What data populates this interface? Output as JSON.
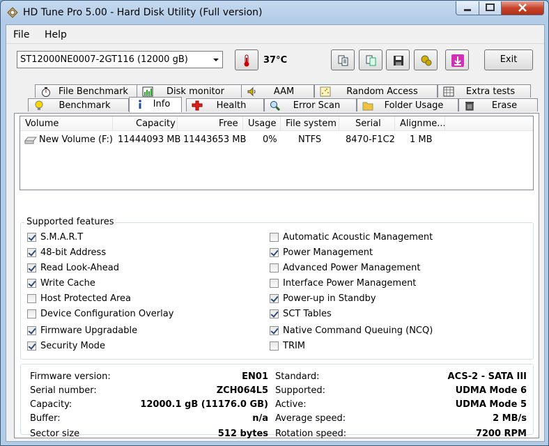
{
  "window": {
    "title": "HD Tune Pro 5.00 - Hard Disk Utility (Full version)"
  },
  "menu": {
    "file": "File",
    "help": "Help"
  },
  "toolbar": {
    "drive": "ST12000NE0007-2GT116 (12000 gB)",
    "temperature": "37°C",
    "exit_label": "Exit"
  },
  "tabs_top": [
    {
      "label": "File Benchmark",
      "icon": "stopwatch-icon"
    },
    {
      "label": "Disk monitor",
      "icon": "chart-icon"
    },
    {
      "label": "AAM",
      "icon": "speaker-icon"
    },
    {
      "label": "Random Access",
      "icon": "scatter-icon"
    },
    {
      "label": "Extra tests",
      "icon": "grid-icon"
    }
  ],
  "tabs_bottom": [
    {
      "label": "Benchmark",
      "icon": "bulb-icon"
    },
    {
      "label": "Info",
      "icon": "info-icon"
    },
    {
      "label": "Health",
      "icon": "cross-icon"
    },
    {
      "label": "Error Scan",
      "icon": "magnifier-icon"
    },
    {
      "label": "Folder Usage",
      "icon": "folder-icon"
    },
    {
      "label": "Erase",
      "icon": "trash-icon"
    }
  ],
  "volumes": {
    "headers": [
      "Volume",
      "Capacity",
      "Free",
      "Usage",
      "File system",
      "Serial",
      "Alignme..."
    ],
    "rows": [
      [
        "New Volume (F:)",
        "11444093 MB",
        "11443653 MB",
        "0%",
        "NTFS",
        "8470-F1C2",
        "1 MB"
      ]
    ]
  },
  "features": {
    "title": "Supported features",
    "left": [
      {
        "label": "S.M.A.R.T",
        "checked": true
      },
      {
        "label": "48-bit Address",
        "checked": true
      },
      {
        "label": "Read Look-Ahead",
        "checked": true
      },
      {
        "label": "Write Cache",
        "checked": true
      },
      {
        "label": "Host Protected Area",
        "checked": false
      },
      {
        "label": "Device Configuration Overlay",
        "checked": false
      },
      {
        "label": "Firmware Upgradable",
        "checked": true
      },
      {
        "label": "Security Mode",
        "checked": true
      }
    ],
    "right": [
      {
        "label": "Automatic Acoustic Management",
        "checked": false
      },
      {
        "label": "Power Management",
        "checked": true
      },
      {
        "label": "Advanced Power Management",
        "checked": false
      },
      {
        "label": "Interface Power Management",
        "checked": false
      },
      {
        "label": "Power-up in Standby",
        "checked": true
      },
      {
        "label": "SCT Tables",
        "checked": true
      },
      {
        "label": "Native Command Queuing (NCQ)",
        "checked": true
      },
      {
        "label": "TRIM",
        "checked": false
      }
    ]
  },
  "info": {
    "left": [
      {
        "label": "Firmware version:",
        "value": "EN01"
      },
      {
        "label": "Serial number:",
        "value": "ZCH064L5"
      },
      {
        "label": "Capacity:",
        "value": "12000.1 gB (11176.0 GB)"
      },
      {
        "label": "Buffer:",
        "value": "n/a"
      },
      {
        "label": "Sector size",
        "value": "512 bytes"
      }
    ],
    "right": [
      {
        "label": "Standard:",
        "value": "ACS-2 - SATA III"
      },
      {
        "label": "Supported:",
        "value": "UDMA Mode 6"
      },
      {
        "label": "Active:",
        "value": "UDMA Mode 5"
      },
      {
        "label": "Average speed:",
        "value": "2 MB/s"
      },
      {
        "label": "Rotation speed:",
        "value": "7200 RPM"
      }
    ]
  }
}
